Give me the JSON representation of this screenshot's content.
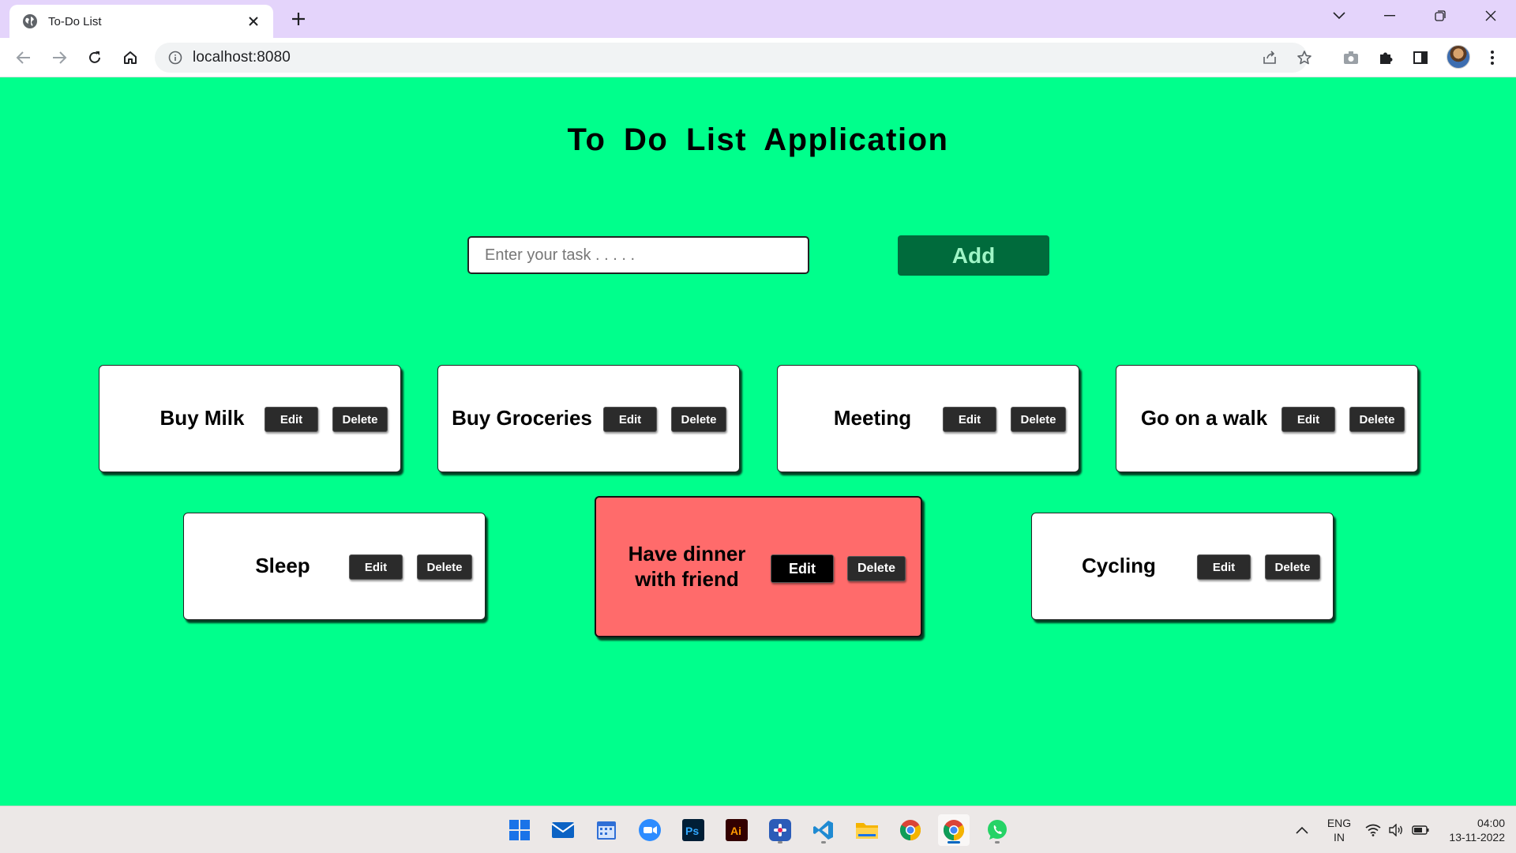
{
  "browser": {
    "tab_title": "To-Do List",
    "url": "localhost:8080"
  },
  "app": {
    "title": "To Do List Application",
    "input": {
      "placeholder": "Enter your task . . . . .",
      "value": ""
    },
    "add_label": "Add",
    "tasks": [
      {
        "label": "Buy Milk",
        "edit": "Edit",
        "delete": "Delete",
        "highlighted": false
      },
      {
        "label": "Buy Groceries",
        "edit": "Edit",
        "delete": "Delete",
        "highlighted": false
      },
      {
        "label": "Meeting",
        "edit": "Edit",
        "delete": "Delete",
        "highlighted": false
      },
      {
        "label": "Go on a walk",
        "edit": "Edit",
        "delete": "Delete",
        "highlighted": false
      },
      {
        "label": "Sleep",
        "edit": "Edit",
        "delete": "Delete",
        "highlighted": false
      },
      {
        "label": "Have dinner with friend",
        "edit": "Edit",
        "delete": "Delete",
        "highlighted": true
      },
      {
        "label": "Cycling",
        "edit": "Edit",
        "delete": "Delete",
        "highlighted": false
      }
    ]
  },
  "colors": {
    "page_background": "#00ff8c",
    "add_button": "#006b3c",
    "highlight_card": "#ff6b6b",
    "tab_strip": "#e4d4fb"
  },
  "taskbar": {
    "apps": [
      "windows-start-icon",
      "mail-icon",
      "calendar-icon",
      "zoom-icon",
      "photoshop-icon",
      "illustrator-icon",
      "slack-icon",
      "vscode-icon",
      "file-explorer-icon",
      "chrome-icon",
      "chrome-icon",
      "whatsapp-icon"
    ],
    "lang_primary": "ENG",
    "lang_secondary": "IN",
    "time": "04:00",
    "date": "13-11-2022"
  }
}
